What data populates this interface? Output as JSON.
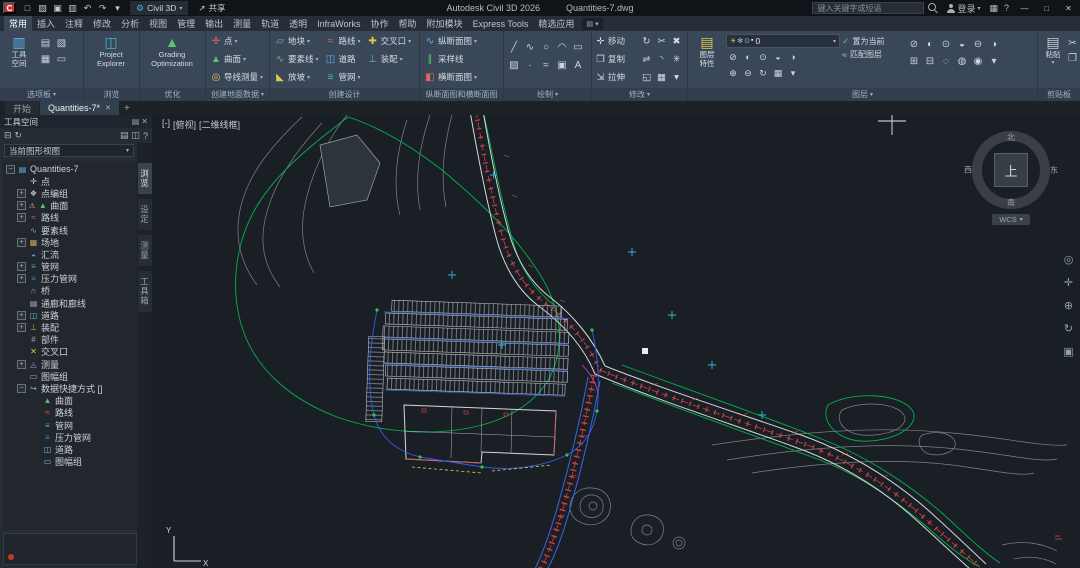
{
  "titlebar": {
    "app_logo": "C",
    "workspace": "Civil 3D",
    "share": "共享",
    "share_glyph": "↗",
    "app_title": "Autodesk Civil 3D 2026",
    "doc_title": "Quantities-7.dwg",
    "search_placeholder": "键入关键字或短语",
    "sign_in": "登录",
    "qat": [
      {
        "name": "new-file-icon",
        "glyph": "□"
      },
      {
        "name": "open-file-icon",
        "glyph": "▨"
      },
      {
        "name": "save-icon",
        "glyph": "▣"
      },
      {
        "name": "plot-icon",
        "glyph": "▥"
      },
      {
        "name": "undo-icon",
        "glyph": "↶"
      },
      {
        "name": "redo-icon",
        "glyph": "↷"
      },
      {
        "name": "qat-dropdown-icon",
        "glyph": "▾"
      }
    ],
    "right_icons": [
      {
        "name": "app-store-icon",
        "glyph": "▦"
      },
      {
        "name": "help-icon",
        "glyph": "?"
      }
    ],
    "window": {
      "min": "—",
      "max": "□",
      "close": "✕"
    }
  },
  "ribbon": {
    "tabs": [
      {
        "label": "常用",
        "active": "true"
      },
      {
        "label": "插入",
        "active": "false"
      },
      {
        "label": "注释",
        "active": "false"
      },
      {
        "label": "修改",
        "active": "false"
      },
      {
        "label": "分析",
        "active": "false"
      },
      {
        "label": "视图",
        "active": "false"
      },
      {
        "label": "管理",
        "active": "false"
      },
      {
        "label": "输出",
        "active": "false"
      },
      {
        "label": "测量",
        "active": "false"
      },
      {
        "label": "轨道",
        "active": "false"
      },
      {
        "label": "透明",
        "active": "false"
      },
      {
        "label": "InfraWorks",
        "active": "false"
      },
      {
        "label": "协作",
        "active": "false"
      },
      {
        "label": "帮助",
        "active": "false"
      },
      {
        "label": "附加模块",
        "active": "false"
      },
      {
        "label": "Express Tools",
        "active": "false"
      },
      {
        "label": "精选应用",
        "active": "false"
      }
    ],
    "ribbon_toggle": "▾",
    "palettes": {
      "label": "选项板",
      "label_caret": "▾",
      "big1": "工具",
      "big2": "空间",
      "big_glyph": "▥",
      "minis": [
        {
          "name": "properties-palette-icon",
          "glyph": "▤"
        },
        {
          "name": "tool-palettes-icon",
          "glyph": "▧"
        },
        {
          "name": "sheet-set-icon",
          "glyph": "▦"
        },
        {
          "name": "command-line-icon",
          "glyph": "▭"
        }
      ]
    },
    "browse": {
      "label": "浏览",
      "label_caret": "",
      "big1": "Project",
      "big2": "Explorer",
      "big_glyph": "◫"
    },
    "optimize": {
      "label": "优化",
      "label_caret": "",
      "big1": "Grading",
      "big2": "Optimization",
      "big_glyph": "▲"
    },
    "ground": {
      "label": "创建地面数据",
      "label_caret": "▾",
      "items": [
        {
          "name": "points-button",
          "glyph": "✛",
          "color": "#e06a5a",
          "label": "点",
          "caret": "▾"
        },
        {
          "name": "surfaces-button",
          "glyph": "▲",
          "color": "#5cc46a",
          "label": "曲面",
          "caret": "▾"
        },
        {
          "name": "traverse-button",
          "glyph": "◎",
          "color": "#e2c44a",
          "label": "导线测量",
          "caret": "▾"
        }
      ]
    },
    "design": {
      "label": "创建设计",
      "label_caret": "",
      "col1": [
        {
          "name": "parcel-button",
          "glyph": "▱",
          "color": "#5fb3e8",
          "label": "地块",
          "caret": "▾"
        },
        {
          "name": "feature-line-button",
          "glyph": "∿",
          "color": "#5cc46a",
          "label": "要素线",
          "caret": "▾"
        },
        {
          "name": "grading-button",
          "glyph": "◣",
          "color": "#e2c44a",
          "label": "放坡",
          "caret": "▾"
        }
      ],
      "col2": [
        {
          "name": "alignment-button",
          "glyph": "≈",
          "color": "#e06a5a",
          "label": "路线",
          "caret": "▾"
        },
        {
          "name": "corridor-button",
          "glyph": "◫",
          "color": "#5fb3e8",
          "label": "道路",
          "caret": ""
        },
        {
          "name": "pipe-network-button",
          "glyph": "≡",
          "color": "#3fb6c9",
          "label": "管网",
          "caret": "▾"
        }
      ],
      "col3": [
        {
          "name": "intersection-button",
          "glyph": "✚",
          "color": "#e2c44a",
          "label": "交叉口",
          "caret": "▾"
        },
        {
          "name": "assembly-button",
          "glyph": "⊥",
          "color": "#5fb3e8",
          "label": "装配",
          "caret": "▾"
        }
      ]
    },
    "profiles": {
      "label": "纵断面图和横断面图",
      "label_caret": "",
      "items": [
        {
          "name": "profile-view-button",
          "glyph": "∿",
          "color": "#5fb3e8",
          "label": "纵断面图",
          "caret": "▾"
        },
        {
          "name": "sample-lines-button",
          "glyph": "∥",
          "color": "#5cc46a",
          "label": "采样线",
          "caret": ""
        },
        {
          "name": "section-view-button",
          "glyph": "◧",
          "color": "#e06a5a",
          "label": "横断面图",
          "caret": "▾"
        }
      ]
    },
    "draw": {
      "label": "绘制",
      "label_caret": "▾",
      "icons": [
        {
          "name": "line-icon",
          "glyph": "╱"
        },
        {
          "name": "polyline-icon",
          "glyph": "∿"
        },
        {
          "name": "circle-icon",
          "glyph": "○"
        },
        {
          "name": "arc-icon",
          "glyph": "◠"
        },
        {
          "name": "rectangle-icon",
          "glyph": "▭"
        },
        {
          "name": "hatch-icon",
          "glyph": "▨"
        },
        {
          "name": "point-icon",
          "glyph": "∙"
        },
        {
          "name": "spline-icon",
          "glyph": "≈"
        },
        {
          "name": "region-icon",
          "glyph": "▣"
        },
        {
          "name": "mtext-icon",
          "glyph": "A"
        }
      ]
    },
    "modify": {
      "label": "修改",
      "label_caret": "▾",
      "items": [
        {
          "glyph": "✛",
          "label": "移动",
          "name": "move-button"
        },
        {
          "glyph": "↻",
          "label": "",
          "name": "rotate-button"
        },
        {
          "glyph": "✂",
          "label": "",
          "name": "trim-button"
        },
        {
          "glyph": "✖",
          "label": "",
          "name": "erase-button"
        },
        {
          "glyph": "❐",
          "label": "复制",
          "name": "copy-button"
        },
        {
          "glyph": "⇌",
          "label": "",
          "name": "mirror-button"
        },
        {
          "glyph": "◝",
          "label": "",
          "name": "fillet-button"
        },
        {
          "glyph": "✳",
          "label": "",
          "name": "explode-button"
        },
        {
          "glyph": "⇲",
          "label": "拉伸",
          "name": "stretch-button"
        },
        {
          "glyph": "◱",
          "label": "",
          "name": "scale-button"
        },
        {
          "glyph": "▦",
          "label": "",
          "name": "array-button"
        },
        {
          "glyph": "▾",
          "label": "",
          "name": "modify-more-button"
        }
      ]
    },
    "layers": {
      "label": "图层",
      "label_caret": "▾",
      "big1": "图层",
      "big2": "特性",
      "big_glyph": "▤",
      "combo_value": "0",
      "combo_caret": "▾",
      "combo_icons": [
        {
          "name": "layer-on-icon",
          "glyph": "☀",
          "color": "#e2c44a"
        },
        {
          "name": "layer-freeze-icon",
          "glyph": "✻",
          "color": "#8fc7e8"
        },
        {
          "name": "layer-lock-icon",
          "glyph": "⊙",
          "color": "#aeb6bf"
        },
        {
          "name": "layer-color-chip",
          "glyph": "▪",
          "color": "#e8e8e8"
        }
      ],
      "tools1": [
        {
          "name": "layer-off-icon",
          "glyph": "⊘"
        },
        {
          "name": "layer-isolate-icon",
          "glyph": "◐"
        },
        {
          "name": "layer-lock-tool-icon",
          "glyph": "⊙"
        },
        {
          "name": "layer-freeze-tool-icon",
          "glyph": "◒"
        },
        {
          "name": "layer-unisolate-icon",
          "glyph": "◑"
        }
      ],
      "tools2": [
        {
          "name": "layer-thaw-icon",
          "glyph": "⊕"
        },
        {
          "name": "layer-delete-icon",
          "glyph": "⊖"
        },
        {
          "name": "layer-prev-icon",
          "glyph": "↻"
        },
        {
          "name": "layer-merge-icon",
          "glyph": "▦"
        },
        {
          "name": "layer-more-icon",
          "glyph": "▾"
        }
      ],
      "make_current": "置为当前",
      "make_current_glyph": "✓",
      "match_layer": "匹配图层",
      "match_layer_glyph": "≈",
      "extra": [
        {
          "name": "layer-tool-icon",
          "glyph": "⊘"
        },
        {
          "name": "layer-tool-icon",
          "glyph": "◐"
        },
        {
          "name": "layer-tool-icon",
          "glyph": "⊙"
        },
        {
          "name": "layer-tool-icon",
          "glyph": "◒"
        },
        {
          "name": "layer-tool-icon",
          "glyph": "⊖"
        },
        {
          "name": "layer-tool-icon",
          "glyph": "◑"
        },
        {
          "name": "layer-tool-icon",
          "glyph": "⊞"
        },
        {
          "name": "layer-tool-icon",
          "glyph": "⊟"
        },
        {
          "name": "layer-tool-icon",
          "glyph": "◌"
        },
        {
          "name": "layer-tool-icon",
          "glyph": "◍"
        },
        {
          "name": "layer-tool-icon",
          "glyph": "◉"
        },
        {
          "name": "layer-tool-icon",
          "glyph": "▾"
        }
      ]
    },
    "clipboard": {
      "label": "剪贴板",
      "label_caret": "",
      "big": "粘贴",
      "big_glyph": "▤",
      "big_caret": "▾",
      "side": [
        {
          "name": "cut-icon",
          "glyph": "✂"
        },
        {
          "name": "copy-clip-icon",
          "glyph": "❐"
        }
      ]
    }
  },
  "file_tabs": {
    "start": "开始",
    "doc": "Quantities-7*",
    "close": "✕",
    "add": "+"
  },
  "toolspace": {
    "title": "工具空间",
    "header_icons": [
      {
        "name": "palette-menu-icon",
        "glyph": "▤"
      },
      {
        "name": "palette-close-icon",
        "glyph": "✕"
      }
    ],
    "toolbar_left": [
      {
        "name": "collapse-all-icon",
        "glyph": "⊟"
      },
      {
        "name": "refresh-icon",
        "glyph": "↻"
      }
    ],
    "toolbar_right": [
      {
        "name": "panorama-icon",
        "glyph": "▤"
      },
      {
        "name": "preview-ic on-icon",
        "glyph": "◫"
      },
      {
        "name": "toolspace-help-icon",
        "glyph": "?"
      }
    ],
    "combo_label": "当前图形视图",
    "combo_caret": "▾",
    "side_tabs": [
      {
        "label": "浏览",
        "active": "true"
      },
      {
        "label": "设定",
        "active": "false"
      },
      {
        "label": "测量",
        "active": "false"
      },
      {
        "label": "工具箱",
        "active": "false"
      }
    ],
    "tree": [
      {
        "label": "Quantities-7",
        "exp": "−",
        "glyph": "▤",
        "color": "#6fb3e0",
        "pad": "3",
        "warn": ""
      },
      {
        "label": "点",
        "exp": "",
        "glyph": "✛",
        "color": "#c2c8ce",
        "pad": "14",
        "warn": ""
      },
      {
        "label": "点编组",
        "exp": "+",
        "glyph": "❖",
        "color": "#c2c8ce",
        "pad": "14",
        "warn": ""
      },
      {
        "label": "曲面",
        "exp": "+",
        "glyph": "▲",
        "color": "#5cc46a",
        "pad": "14",
        "warn": "⚠"
      },
      {
        "label": "路线",
        "exp": "+",
        "glyph": "≈",
        "color": "#e06a5a",
        "pad": "14",
        "warn": ""
      },
      {
        "label": "要素线",
        "exp": "",
        "glyph": "∿",
        "color": "#5cc46a",
        "pad": "14",
        "warn": ""
      },
      {
        "label": "场地",
        "exp": "+",
        "glyph": "▦",
        "color": "#c8a35c",
        "pad": "14",
        "warn": ""
      },
      {
        "label": "汇流",
        "exp": "",
        "glyph": "◒",
        "color": "#4fa3e0",
        "pad": "14",
        "warn": ""
      },
      {
        "label": "管网",
        "exp": "+",
        "glyph": "≡",
        "color": "#3fb6c9",
        "pad": "14",
        "warn": ""
      },
      {
        "label": "压力管网",
        "exp": "+",
        "glyph": "≡",
        "color": "#2f8fd4",
        "pad": "14",
        "warn": ""
      },
      {
        "label": "桥",
        "exp": "",
        "glyph": "∩",
        "color": "#aeb4bb",
        "pad": "14",
        "warn": ""
      },
      {
        "label": "通廊和廊线",
        "exp": "",
        "glyph": "▤",
        "color": "#aeb4bb",
        "pad": "14",
        "warn": ""
      },
      {
        "label": "道路",
        "exp": "+",
        "glyph": "◫",
        "color": "#5fb3e8",
        "pad": "14",
        "warn": ""
      },
      {
        "label": "装配",
        "exp": "+",
        "glyph": "⊥",
        "color": "#e0a23c",
        "pad": "14",
        "warn": ""
      },
      {
        "label": "部件",
        "exp": "",
        "glyph": "#",
        "color": "#9aa2ab",
        "pad": "14",
        "warn": ""
      },
      {
        "label": "交叉口",
        "exp": "",
        "glyph": "✕",
        "color": "#e2c44a",
        "pad": "14",
        "warn": ""
      },
      {
        "label": "测量",
        "exp": "+",
        "glyph": "◬",
        "color": "#b07fe0",
        "pad": "14",
        "warn": ""
      },
      {
        "label": "图幅组",
        "exp": "",
        "glyph": "▭",
        "color": "#9ab0c0",
        "pad": "14",
        "warn": ""
      },
      {
        "label": "数据快捷方式 []",
        "exp": "−",
        "glyph": "↪",
        "color": "#6fb3e0",
        "pad": "14",
        "warn": ""
      },
      {
        "label": "曲面",
        "exp": "",
        "glyph": "▲",
        "color": "#5cc46a",
        "pad": "28",
        "warn": ""
      },
      {
        "label": "路线",
        "exp": "",
        "glyph": "≈",
        "color": "#e06a5a",
        "pad": "28",
        "warn": ""
      },
      {
        "label": "管网",
        "exp": "",
        "glyph": "≡",
        "color": "#3fb6c9",
        "pad": "28",
        "warn": ""
      },
      {
        "label": "压力管网",
        "exp": "",
        "glyph": "≡",
        "color": "#2f8fd4",
        "pad": "28",
        "warn": ""
      },
      {
        "label": "道路",
        "exp": "",
        "glyph": "◫",
        "color": "#5fb3e8",
        "pad": "28",
        "warn": ""
      },
      {
        "label": "图幅组",
        "exp": "",
        "glyph": "▭",
        "color": "#9ab0c0",
        "pad": "28",
        "warn": ""
      }
    ]
  },
  "canvas": {
    "viewport_controls": {
      "menu": "[-]",
      "view": "[俯视]",
      "visual": "[二维线框]"
    },
    "viewcube": {
      "north": "北",
      "south": "南",
      "east": "东",
      "west": "西",
      "top": "上",
      "wcs": "WCS",
      "wcs_caret": "▾"
    },
    "navbar": [
      {
        "name": "navigation-wheel-icon",
        "glyph": "◎"
      },
      {
        "name": "pan-icon",
        "glyph": "✛"
      },
      {
        "name": "zoom-icon",
        "glyph": "⊕"
      },
      {
        "name": "orbit-icon",
        "glyph": "↻"
      },
      {
        "name": "showmotion-icon",
        "glyph": "▣"
      }
    ],
    "ucs": {
      "x": "X",
      "y": "Y"
    },
    "colors": {
      "boundary_green": "#00b24a",
      "road_tick_red": "#e04545",
      "pipe_blue": "#2e5fe8",
      "rail_blue": "#3b66e0",
      "contour_gray": "#8e959c",
      "point_cyan": "#37b6cf"
    }
  }
}
